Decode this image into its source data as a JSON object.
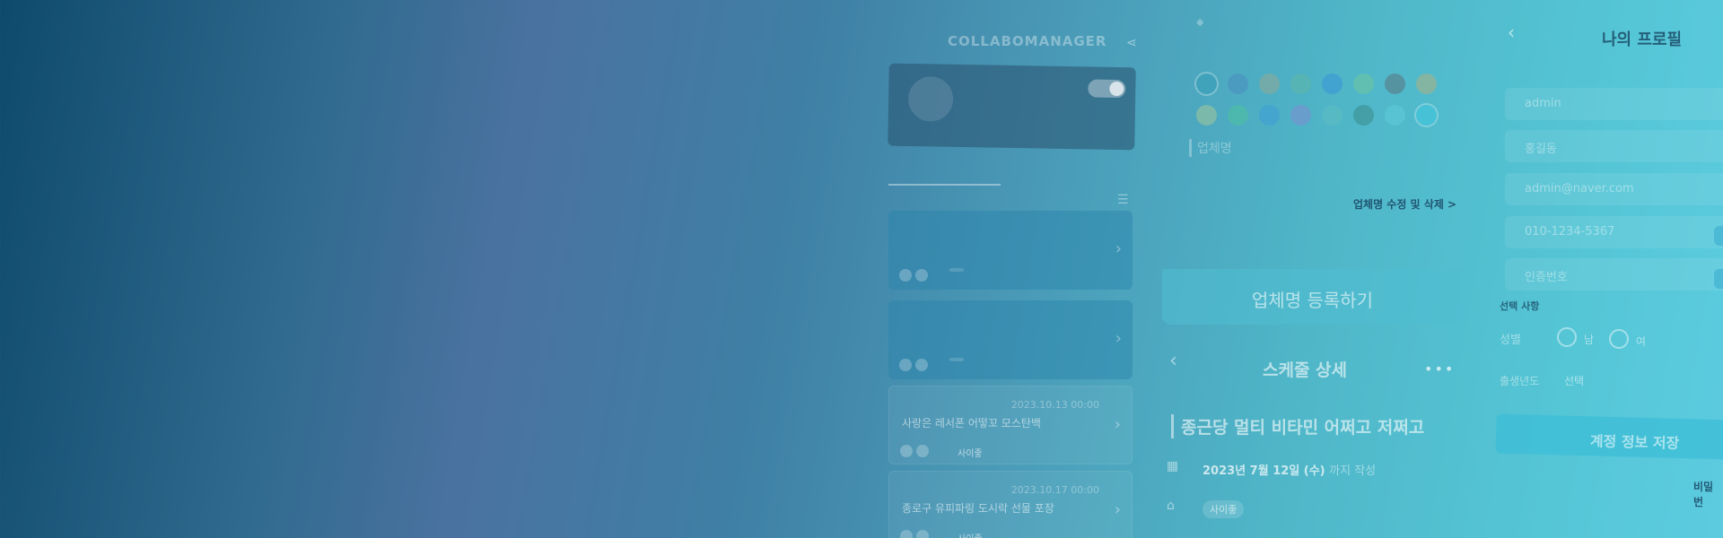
{
  "app_list": {
    "logo": "COLLABOMANAGER",
    "profile_lines": [
      "",
      "",
      ""
    ],
    "tabs": [
      "",
      ""
    ],
    "cards": [
      {
        "num": "",
        "title": "",
        "date": "",
        "tag": ""
      },
      {
        "num": "",
        "title": "",
        "date": "",
        "tag": ""
      },
      {
        "num": "",
        "title": "사랑은 레서폰 어떻꼬 모스탄백",
        "date": "2023.10.13 00:00",
        "tag": "사이좋"
      },
      {
        "num": "",
        "title": "종로구 유피파링 도시락 선물 포장",
        "date": "2023.10.17 00:00",
        "tag": "사이좋"
      }
    ]
  },
  "vendor_form": {
    "field_label": "업체명",
    "edit_link": "업체명 수정 및 삭제 >",
    "register_button": "업체명 등록하기",
    "swatch_colors": [
      "#3aa0b8",
      "#4b8fc0",
      "#8aa89a",
      "#5bb5a8",
      "#3b98d6",
      "#6cc4a0",
      "#5a7a86",
      "#a6b086",
      "#9bc49b",
      "#4fc0a0",
      "#3f9fd6",
      "#7a8fd0",
      "#5dbcc0",
      "#3c8f90",
      "#5ecad8",
      "#3fc6dc"
    ]
  },
  "schedule": {
    "title": "스케줄 상세",
    "more": "•••",
    "subject": "종근당 멀티 비타민 어쩌고 저쩌고",
    "date": "2023년 7월 12일 (수)",
    "date_suffix": "까지 작성",
    "tag": "사이좋"
  },
  "profile": {
    "title": "나의 프로필",
    "fields": [
      "admin",
      "홍길동",
      "admin@naver.com",
      "010-1234-5367",
      "인증번호"
    ],
    "optional_label": "선택 사항",
    "gender_label": "성별",
    "gender_options": [
      "남",
      "여"
    ],
    "year_label": "출생년도",
    "year_value": "선택",
    "save_button": "계정 정보 저장",
    "password_link": "비밀번"
  }
}
